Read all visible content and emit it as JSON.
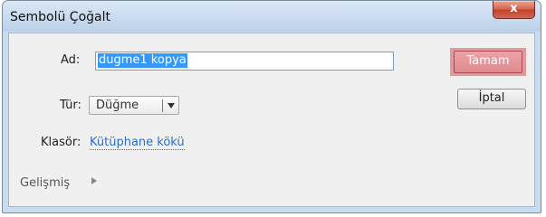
{
  "window": {
    "title": "Sembolü Çoğalt",
    "close_label": "x"
  },
  "form": {
    "name_label": "Ad:",
    "name_value": "dugme1 kopya",
    "type_label": "Tür:",
    "type_value": "Düğme",
    "folder_label": "Klasör:",
    "folder_value": "Kütüphane kökü",
    "advanced_label": "Gelişmiş"
  },
  "buttons": {
    "ok_label": "Tamam",
    "cancel_label": "İptal"
  },
  "colors": {
    "ok_highlight": "#e5989c",
    "link": "#2a6fc3",
    "selection": "#3399ff"
  }
}
